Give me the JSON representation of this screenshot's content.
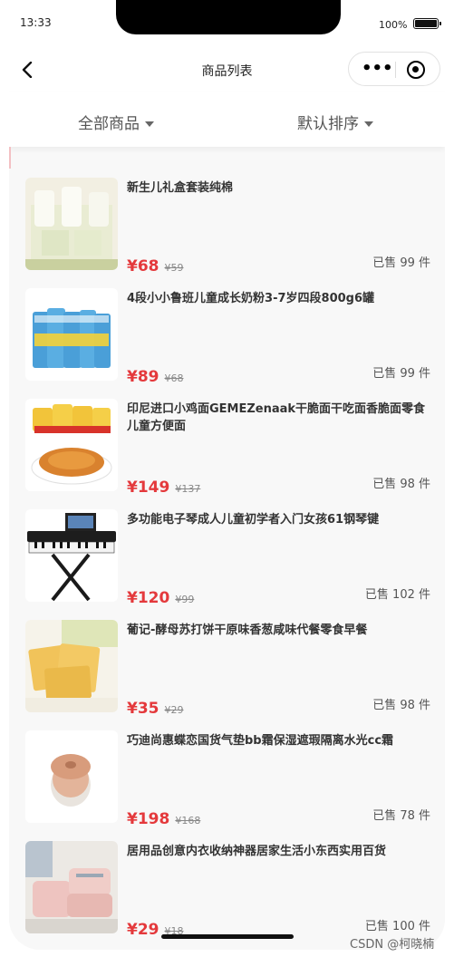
{
  "status": {
    "time": "13:33",
    "battery": "100%"
  },
  "nav": {
    "title": "商品列表",
    "more_icon": "•••"
  },
  "filters": {
    "all": "全部商品",
    "sort": "默认排序"
  },
  "colors": {
    "price": "#e4393c",
    "background": "#f8f8f8"
  },
  "items": [
    {
      "title": "新生儿礼盒套装纯棉",
      "price": "¥68",
      "original": "¥59",
      "sold": "已售 99 件",
      "image": "baby-gift-box"
    },
    {
      "title": "4段小小鲁班儿童成长奶粉3-7岁四段800g6罐",
      "price": "¥89",
      "original": "¥68",
      "sold": "已售 99 件",
      "image": "milk-powder-cans"
    },
    {
      "title": "印尼进口小鸡面GEMEZenaak干脆面干吃面香脆面零食儿童方便面",
      "price": "¥149",
      "original": "¥137",
      "sold": "已售 98 件",
      "image": "snack-noodles"
    },
    {
      "title": "多功能电子琴成人儿童初学者入门女孩61钢琴键",
      "price": "¥120",
      "original": "¥99",
      "sold": "已售 102 件",
      "image": "electronic-keyboard"
    },
    {
      "title": "葡记-酵母苏打饼干原味香葱咸味代餐零食早餐",
      "price": "¥35",
      "original": "¥29",
      "sold": "已售 98 件",
      "image": "soda-crackers"
    },
    {
      "title": "巧迪尚惠蝶恋国货气垫bb霜保湿遮瑕隔离水光cc霜",
      "price": "¥198",
      "original": "¥168",
      "sold": "已售 78 件",
      "image": "cushion-compact"
    },
    {
      "title": "居用品创意内衣收纳神器居家生活小东西实用百货",
      "price": "¥29",
      "original": "¥18",
      "sold": "已售 100 件",
      "image": "storage-box"
    }
  ],
  "watermark": "CSDN @柯晓楠"
}
